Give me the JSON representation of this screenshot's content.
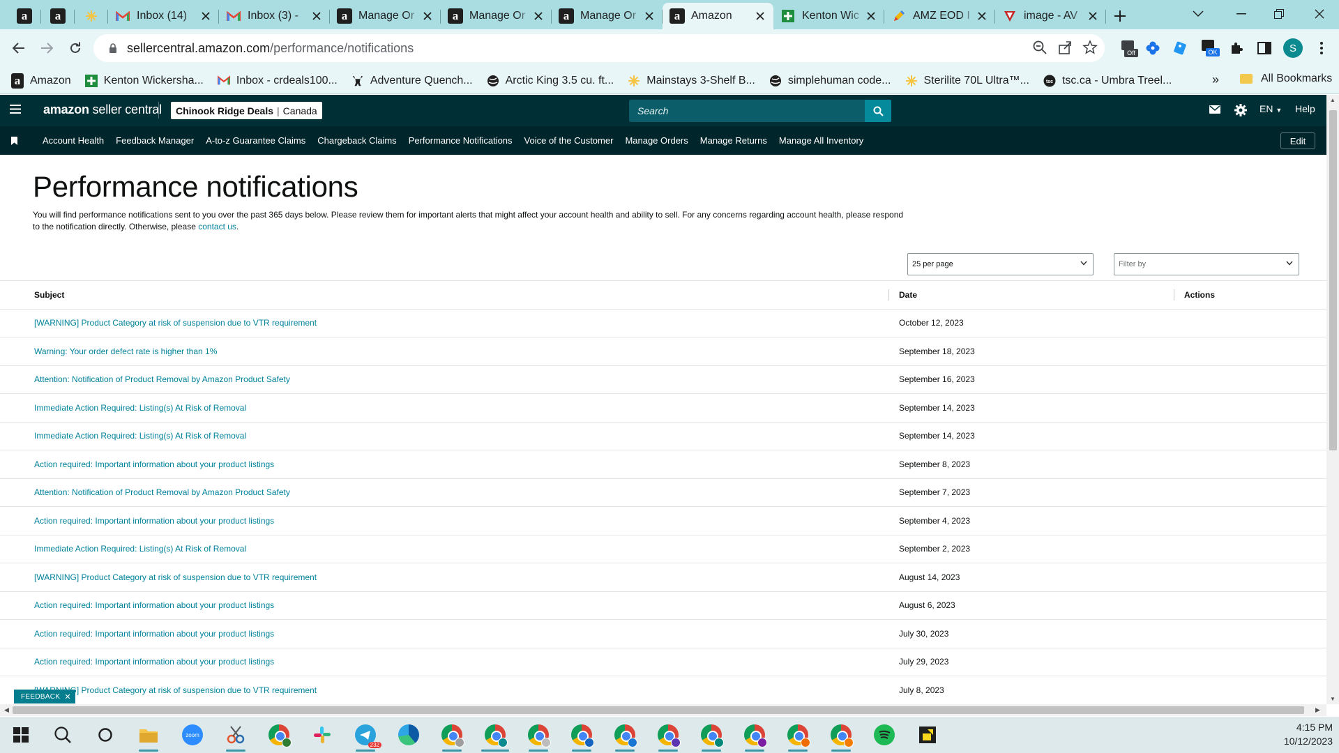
{
  "browser": {
    "tabs": [
      {
        "type": "pinned",
        "icon": "amazon",
        "title": ""
      },
      {
        "type": "pinned",
        "icon": "amazon",
        "title": ""
      },
      {
        "type": "pinned",
        "icon": "sparkle",
        "title": ""
      },
      {
        "type": "normal",
        "icon": "gmail",
        "title": "Inbox (14)"
      },
      {
        "type": "normal",
        "icon": "gmail",
        "title": "Inbox (3) -"
      },
      {
        "type": "normal",
        "icon": "amazon",
        "title": "Manage Or"
      },
      {
        "type": "normal",
        "icon": "amazon",
        "title": "Manage Or"
      },
      {
        "type": "normal",
        "icon": "amazon",
        "title": "Manage Or"
      },
      {
        "type": "active",
        "icon": "amazon",
        "title": "Amazon"
      },
      {
        "type": "normal",
        "icon": "sheets",
        "title": "Kenton Wic"
      },
      {
        "type": "normal",
        "icon": "pencil",
        "title": "AMZ EOD I"
      },
      {
        "type": "normal",
        "icon": "v-logo",
        "title": "image - AV"
      }
    ],
    "url_domain": "sellercentral.amazon.com",
    "url_path": "/performance/notifications",
    "extension_badges": {
      "off": "Off",
      "ok": "OK"
    },
    "profile_initial": "S",
    "bookmarks": [
      {
        "icon": "amazon",
        "label": "Amazon"
      },
      {
        "icon": "sheets",
        "label": "Kenton Wickersha..."
      },
      {
        "icon": "gmail",
        "label": "Inbox - crdeals100..."
      },
      {
        "icon": "moose",
        "label": "Adventure Quench..."
      },
      {
        "icon": "globe",
        "label": "Arctic King 3.5 cu. ft..."
      },
      {
        "icon": "sparkle",
        "label": "Mainstays 3-Shelf B..."
      },
      {
        "icon": "globe",
        "label": "simplehuman code..."
      },
      {
        "icon": "sparkle",
        "label": "Sterilite 70L Ultra™..."
      },
      {
        "icon": "tsc",
        "label": "tsc.ca - Umbra Treel..."
      }
    ],
    "bookmarks_more": "»",
    "all_bookmarks": "All Bookmarks"
  },
  "seller_central": {
    "logo_bold": "amazon",
    "logo_rest": " seller central",
    "store_name": "Chinook Ridge Deals",
    "marketplace": "Canada",
    "search_placeholder": "Search",
    "language": "EN",
    "help": "Help",
    "nav_items": [
      "Account Health",
      "Feedback Manager",
      "A-to-z Guarantee Claims",
      "Chargeback Claims",
      "Performance Notifications",
      "Voice of the Customer",
      "Manage Orders",
      "Manage Returns",
      "Manage All Inventory"
    ],
    "edit_label": "Edit"
  },
  "page": {
    "title": "Performance notifications",
    "intro_text": "You will find performance notifications sent to you over the past 365 days below. Please review them for important alerts that might affect your account health and ability to sell. For any concerns regarding account health, please respond to the notification directly. Otherwise, please ",
    "intro_link": "contact us",
    "intro_end": ".",
    "per_page": "25 per page",
    "filter_placeholder": "Filter by",
    "columns": {
      "subject": "Subject",
      "date": "Date",
      "actions": "Actions"
    },
    "rows": [
      {
        "subject": "[WARNING] Product Category at risk of suspension due to VTR requirement",
        "date": "October 12, 2023"
      },
      {
        "subject": "Warning: Your order defect rate is higher than 1%",
        "date": "September 18, 2023"
      },
      {
        "subject": "Attention: Notification of Product Removal by Amazon Product Safety",
        "date": "September 16, 2023"
      },
      {
        "subject": "Immediate Action Required: Listing(s) At Risk of Removal",
        "date": "September 14, 2023"
      },
      {
        "subject": "Immediate Action Required: Listing(s) At Risk of Removal",
        "date": "September 14, 2023"
      },
      {
        "subject": "Action required: Important information about your product listings",
        "date": "September 8, 2023"
      },
      {
        "subject": "Attention: Notification of Product Removal by Amazon Product Safety",
        "date": "September 7, 2023"
      },
      {
        "subject": "Action required: Important information about your product listings",
        "date": "September 4, 2023"
      },
      {
        "subject": "Immediate Action Required: Listing(s) At Risk of Removal",
        "date": "September 2, 2023"
      },
      {
        "subject": "[WARNING] Product Category at risk of suspension due to VTR requirement",
        "date": "August 14, 2023"
      },
      {
        "subject": "Action required: Important information about your product listings",
        "date": "August 6, 2023"
      },
      {
        "subject": "Action required: Important information about your product listings",
        "date": "July 30, 2023"
      },
      {
        "subject": "Action required: Important information about your product listings",
        "date": "July 29, 2023"
      },
      {
        "subject": "[WARNING] Product Category at risk of suspension due to VTR requirement",
        "date": "July 8, 2023"
      }
    ],
    "feedback_label": "FEEDBACK",
    "feedback_close": "✕"
  },
  "taskbar": {
    "telegram_badge": "232",
    "time": "4:15 PM",
    "date": "10/12/2023"
  },
  "colors": {
    "header_bg": "#002f36",
    "nav_bg": "#00252a",
    "link": "#00829b",
    "tabstrip": "#a9dde2"
  }
}
